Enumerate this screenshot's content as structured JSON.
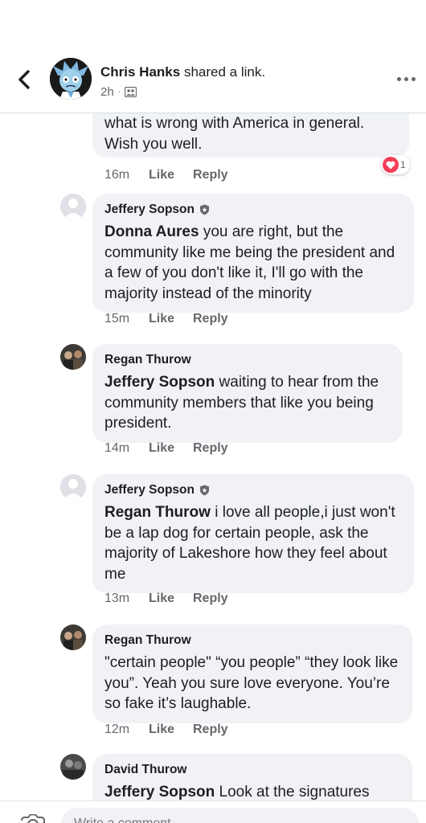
{
  "header": {
    "author": "Chris Hanks",
    "action": "shared a link.",
    "time": "2h",
    "separator": "·",
    "audience_icon": "friends-icon"
  },
  "comments": [
    {
      "author": "",
      "mention": "",
      "text": "what is wrong with America in general. Wish you well.",
      "time": "16m",
      "like": "Like",
      "reply": "Reply",
      "reaction_count": "1"
    },
    {
      "author": "Jeffery Sopson",
      "mention": "Donna Aures",
      "text": " you are right, but the community like me being the president and a few of you don't like it, I'll go with the majority instead of the minority",
      "time": "15m",
      "like": "Like",
      "reply": "Reply"
    },
    {
      "author": "Regan Thurow",
      "mention": "Jeffery Sopson",
      "text": " waiting to hear from the community members that like you being president.",
      "time": "14m",
      "like": "Like",
      "reply": "Reply"
    },
    {
      "author": "Jeffery Sopson",
      "mention": "Regan Thurow",
      "text": " i love all people,i just won't be a lap dog for certain people, ask the majority of Lakeshore how they feel about me",
      "time": "13m",
      "like": "Like",
      "reply": "Reply"
    },
    {
      "author": "Regan Thurow",
      "mention": "",
      "text": "\"certain people\" “you people” “they look like you”. Yeah you sure love everyone. You’re so fake it’s laughable.",
      "time": "12m",
      "like": "Like",
      "reply": "Reply"
    },
    {
      "author": "David Thurow",
      "mention": "Jeffery Sopson",
      "text": " Look at the signatures"
    }
  ],
  "composer": {
    "placeholder": "Write a comment..."
  },
  "colors": {
    "bubble": "#f0f2f5",
    "meta": "#65676b",
    "love": "#f33e58"
  }
}
